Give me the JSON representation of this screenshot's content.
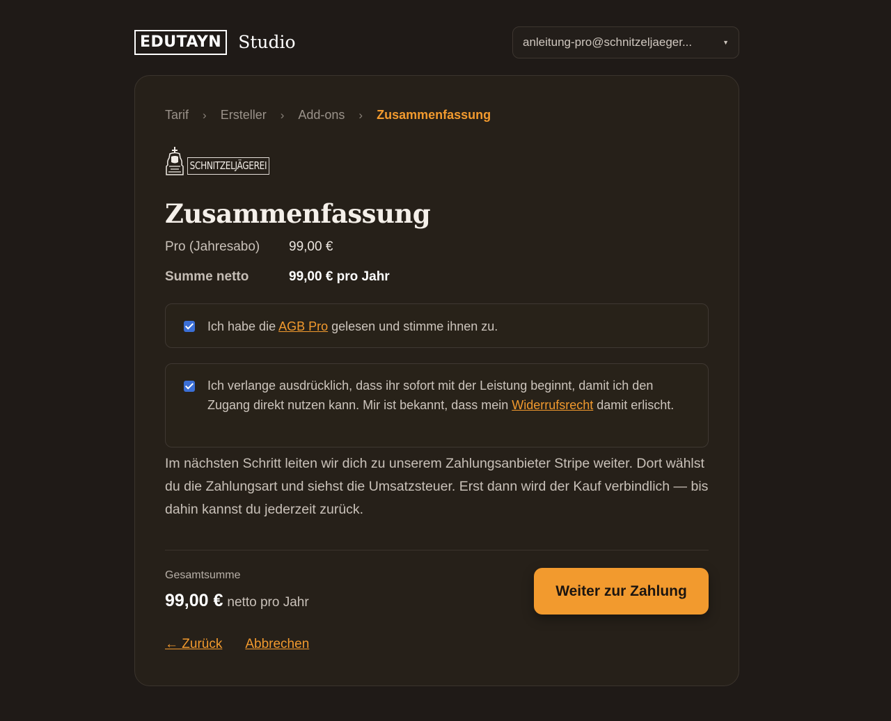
{
  "header": {
    "brand_box": "EDUTAYN",
    "brand_studio": "Studio",
    "account_email": "anleitung-pro@schnitzeljaeger..."
  },
  "breadcrumb": [
    "Tarif",
    "Ersteller",
    "Add-ons",
    "Zusammenfassung"
  ],
  "breadcrumb_separator": "›",
  "org_logo_text": "SCHNITZELJÄGEREI",
  "summary": {
    "title": "Zusammenfassung",
    "plan_label": "Pro (Jahresabo)",
    "plan_price": "99,00 €",
    "net_label": "Summe netto",
    "net_value": "99,00 € pro Jahr"
  },
  "consent1": {
    "checked": true,
    "before": "Ich habe die ",
    "link": "AGB Pro",
    "after": " gelesen und stimme ihnen zu."
  },
  "consent2": {
    "checked": true,
    "before": "Ich verlange ausdrücklich, dass ihr sofort mit der Leistung beginnt, damit ich den Zugang direkt nutzen kann. Mir ist bekannt, dass mein ",
    "link": "Widerrufsrecht",
    "after": " damit erlischt."
  },
  "info_text": "Im nächsten Schritt leiten wir dich zu unserem Zahlungsanbieter Stripe weiter. Dort wählst du die Zahlungsart und siehst die Umsatzsteuer. Erst dann wird der Kauf verbindlich — bis dahin kannst du jederzeit zurück.",
  "footer": {
    "total_label": "Gesamtsumme",
    "total_amount": "99,00 €",
    "total_suffix": "netto pro Jahr",
    "pay_button": "Weiter zur Zahlung",
    "back_link": "← Zurück",
    "cancel_link": "Abbrechen"
  },
  "colors": {
    "background": "#1f1a17",
    "card": "#262019",
    "accent": "#f29a2e",
    "checkbox": "#3b6fd6"
  }
}
